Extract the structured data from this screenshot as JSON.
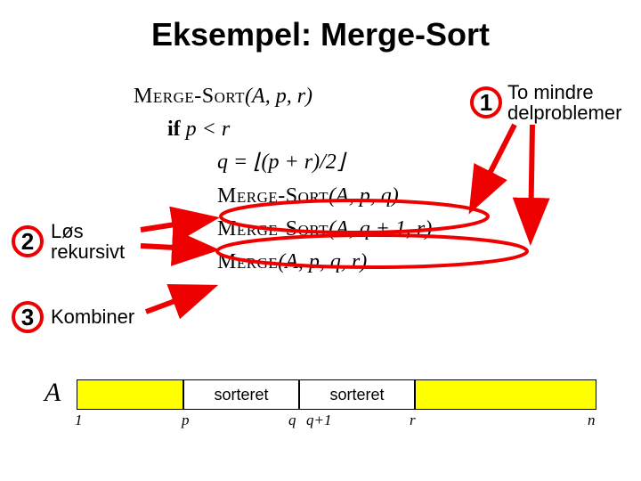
{
  "title": "Eksempel: Merge-Sort",
  "pseudocode": {
    "l1_func": "Merge-Sort",
    "l1_args": "(A, p, r)",
    "l2": "if p < r",
    "l3": "q = ⌊(p + r)/2⌋",
    "l4_func": "Merge-Sort",
    "l4_args": "(A, p, q)",
    "l5_func": "Merge-Sort",
    "l5_args": "(A, q + 1, r)",
    "l6_func": "Merge",
    "l6_args": "(A, p, q, r)"
  },
  "steps": {
    "1": {
      "num": "1",
      "line1": "To mindre",
      "line2": "delproblemer"
    },
    "2": {
      "num": "2",
      "line1": "Løs",
      "line2": "rekursivt"
    },
    "3": {
      "num": "3",
      "text": "Kombiner"
    }
  },
  "array": {
    "label": "A",
    "seg2": "sorteret",
    "seg3": "sorteret",
    "idx1": "1",
    "idxp": "p",
    "idxq": "q",
    "idxq1": "q+1",
    "idxr": "r",
    "idxn": "n"
  }
}
